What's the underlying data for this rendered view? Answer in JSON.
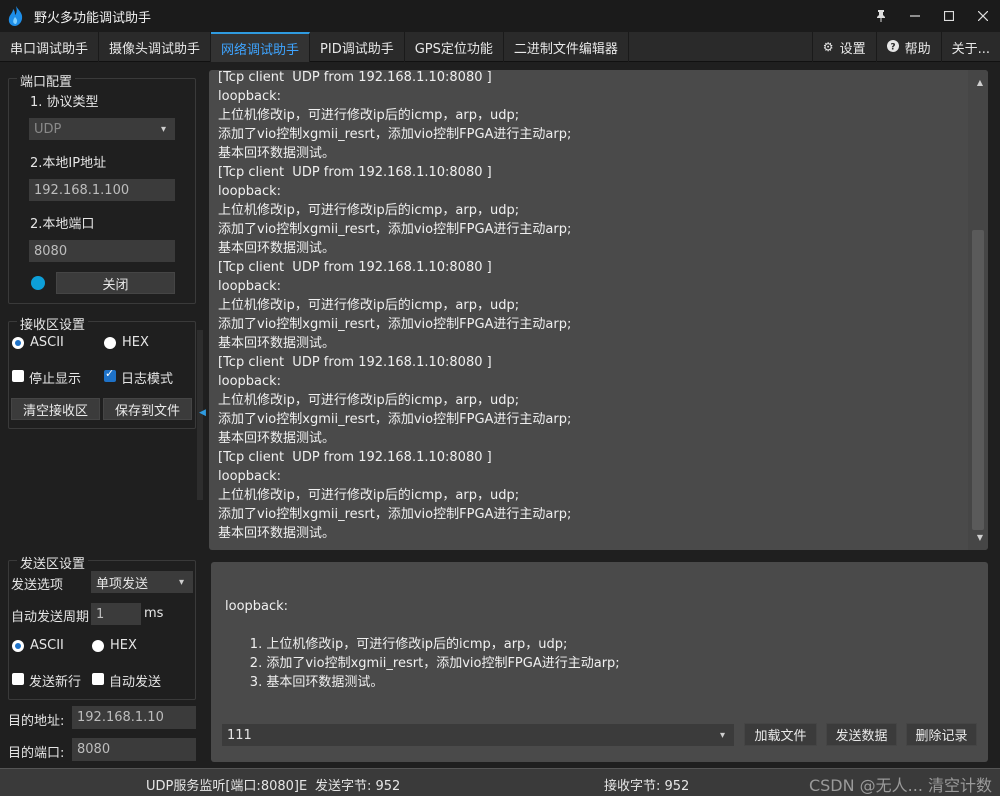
{
  "app": {
    "title": "野火多功能调试助手",
    "icon": "flame-logo-icon"
  },
  "window_controls": [
    "pin-icon",
    "minimize-icon",
    "maximize-icon",
    "close-icon"
  ],
  "tabs": [
    {
      "label": "串口调试助手"
    },
    {
      "label": "摄像头调试助手"
    },
    {
      "label": "网络调试助手",
      "active": true
    },
    {
      "label": "PID调试助手"
    },
    {
      "label": "GPS定位功能"
    },
    {
      "label": "二进制文件编辑器"
    }
  ],
  "tabs_right": [
    {
      "label": "设置",
      "icon": "gear-icon"
    },
    {
      "label": "帮助",
      "icon": "help-icon"
    },
    {
      "label": "关于..."
    }
  ],
  "port_config": {
    "title": "端口配置",
    "protocol_label": "1. 协议类型",
    "protocol_value": "UDP",
    "ip_label": "2.本地IP地址",
    "ip_value": "192.168.1.100",
    "port_label": "2.本地端口",
    "port_value": "8080",
    "close_button": "关闭"
  },
  "receive_settings": {
    "title": "接收区设置",
    "ascii": "ASCII",
    "hex": "HEX",
    "stop_display": "停止显示",
    "log_mode": "日志模式",
    "clear_button": "清空接收区",
    "save_button": "保存到文件"
  },
  "send_settings": {
    "title": "发送区设置",
    "option_label": "发送选项",
    "option_value": "单项发送",
    "period_label": "自动发送周期",
    "period_value": "1",
    "period_unit": "ms",
    "ascii": "ASCII",
    "hex": "HEX",
    "newline": "发送新行",
    "auto_send": "自动发送"
  },
  "target": {
    "addr_label": "目的地址:",
    "addr_value": "192.168.1.10",
    "port_label": "目的端口:",
    "port_value": "8080"
  },
  "receive_area": {
    "text": "[Tcp client  UDP from 192.168.1.10:8080 ]\nloopback:\n上位机修改ip，可进行修改ip后的icmp，arp，udp;\n添加了vio控制xgmii_resrt，添加vio控制FPGA进行主动arp;\n基本回环数据测试。\n[Tcp client  UDP from 192.168.1.10:8080 ]\nloopback:\n上位机修改ip，可进行修改ip后的icmp，arp，udp;\n添加了vio控制xgmii_resrt，添加vio控制FPGA进行主动arp;\n基本回环数据测试。\n[Tcp client  UDP from 192.168.1.10:8080 ]\nloopback:\n上位机修改ip，可进行修改ip后的icmp，arp，udp;\n添加了vio控制xgmii_resrt，添加vio控制FPGA进行主动arp;\n基本回环数据测试。\n[Tcp client  UDP from 192.168.1.10:8080 ]\nloopback:\n上位机修改ip，可进行修改ip后的icmp，arp，udp;\n添加了vio控制xgmii_resrt，添加vio控制FPGA进行主动arp;\n基本回环数据测试。\n[Tcp client  UDP from 192.168.1.10:8080 ]\nloopback:\n上位机修改ip，可进行修改ip后的icmp，arp，udp;\n添加了vio控制xgmii_resrt，添加vio控制FPGA进行主动arp;\n基本回环数据测试。"
  },
  "send_area": {
    "text": "loopback:\n\n      1. 上位机修改ip，可进行修改ip后的icmp，arp，udp;\n      2. 添加了vio控制xgmii_resrt，添加vio控制FPGA进行主动arp;\n      3. 基本回环数据测试。",
    "history_value": "111",
    "load_file_button": "加载文件",
    "send_button": "发送数据",
    "delete_button": "删除记录"
  },
  "status": {
    "listen": "UDP服务监听[端口:8080]E",
    "sent": "发送字节: 952",
    "received": "接收字节: 952",
    "watermark": "CSDN @无人... 清空计数",
    "accent": "#2f9be0"
  }
}
